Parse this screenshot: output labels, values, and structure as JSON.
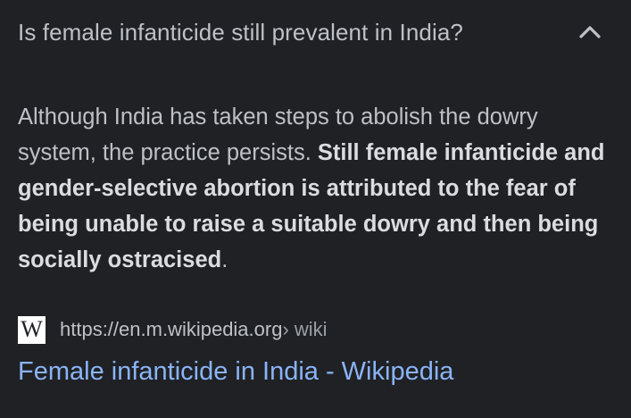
{
  "question": {
    "text": "Is female infanticide still prevalent in India?",
    "toggle_icon": "chevron-up-icon"
  },
  "answer": {
    "plain_intro": "Although India has taken steps to abolish the dowry system, the practice persists. ",
    "bold_highlight": "Still female infanticide and gender-selective abortion is attributed to the fear of being unable to raise a suitable dowry and then being socially ostracised",
    "ending": "."
  },
  "source": {
    "favicon_letter": "W",
    "url": "https://en.m.wikipedia.org",
    "breadcrumb": " › wiki"
  },
  "result": {
    "title": "Female infanticide in India - Wikipedia"
  },
  "colors": {
    "background": "#202124",
    "text": "#bdc1c6",
    "bold_text": "#dadce0",
    "link": "#8ab4f8"
  }
}
